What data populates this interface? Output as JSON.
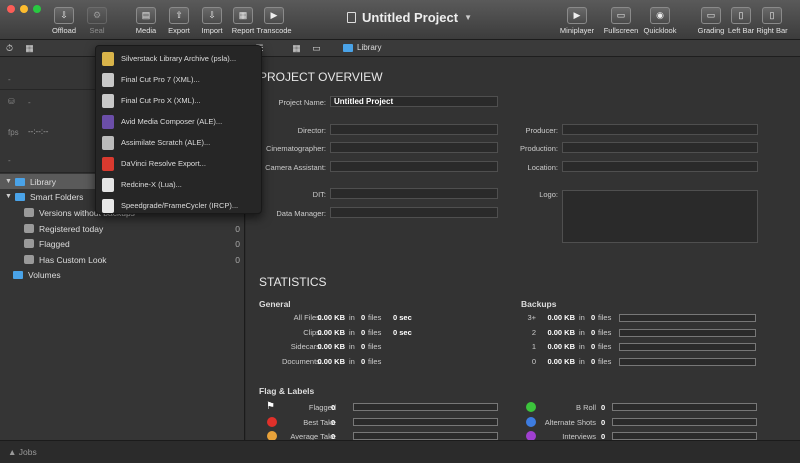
{
  "window": {
    "title": "Untitled Project"
  },
  "toolbar": {
    "offload": "Offload",
    "seal": "Seal",
    "media": "Media",
    "export": "Export",
    "import": "Import",
    "report": "Report",
    "transcode": "Transcode",
    "miniplayer": "Miniplayer",
    "fullscreen": "Fullscreen",
    "quicklook": "Quicklook",
    "grading": "Grading",
    "left_bar": "Left Bar",
    "right_bar": "Right Bar"
  },
  "breadcrumb": {
    "library": "Library"
  },
  "sidebar": {
    "meta": {
      "fps": "fps",
      "fps_value": "--:--:--",
      "dash1": "-",
      "dash2": "-",
      "dash3": "-"
    },
    "library": "Library",
    "smart_folders": "Smart Folders",
    "items": [
      {
        "label": "Versions without backups",
        "count": ""
      },
      {
        "label": "Registered today",
        "count": "0"
      },
      {
        "label": "Flagged",
        "count": "0"
      },
      {
        "label": "Has Custom Look",
        "count": "0"
      }
    ],
    "volumes": "Volumes"
  },
  "export_menu": [
    {
      "label": "Silverstack Library Archive (psla)...",
      "icon": "silverstack-icon",
      "color": "#d9b44a"
    },
    {
      "label": "Final Cut Pro 7 (XML)...",
      "icon": "final-cut-7-icon",
      "color": "#c8c8c8"
    },
    {
      "label": "Final Cut Pro X (XML)...",
      "icon": "final-cut-x-icon",
      "color": "#c8c8c8"
    },
    {
      "label": "Avid Media Composer (ALE)...",
      "icon": "avid-icon",
      "color": "#6b4ea8"
    },
    {
      "label": "Assimilate Scratch (ALE)...",
      "icon": "scratch-icon",
      "color": "#bbbbbb"
    },
    {
      "label": "DaVinci Resolve Export...",
      "icon": "davinci-icon",
      "color": "#d93a2f"
    },
    {
      "label": "Redcine-X (Lua)...",
      "icon": "redcine-icon",
      "color": "#e4e4e4"
    },
    {
      "label": "Speedgrade/FrameCycler (IRCP)...",
      "icon": "speedgrade-icon",
      "color": "#e8e8e8"
    }
  ],
  "project": {
    "heading": "PROJECT OVERVIEW",
    "project_name_label": "Project Name:",
    "project_name": "Untitled Project",
    "director": "Director:",
    "cinematographer": "Cinematographer:",
    "camera_assistant": "Camera Assistant:",
    "dit": "DIT:",
    "data_manager": "Data Manager:",
    "producer": "Producer:",
    "production": "Production:",
    "location": "Location:",
    "logo": "Logo:"
  },
  "statistics": {
    "heading": "STATISTICS",
    "general_title": "General",
    "backups_title": "Backups",
    "in": "in",
    "files": "files",
    "general": [
      {
        "label": "All Files:",
        "size": "0.00 KB",
        "files": "0",
        "duration": "0 sec"
      },
      {
        "label": "Clips:",
        "size": "0.00 KB",
        "files": "0",
        "duration": "0 sec"
      },
      {
        "label": "Sidecars:",
        "size": "0.00 KB",
        "files": "0",
        "duration": ""
      },
      {
        "label": "Documents:",
        "size": "0.00 KB",
        "files": "0",
        "duration": ""
      }
    ],
    "backups": [
      {
        "label": "3+",
        "size": "0.00 KB",
        "files": "0",
        "fill": 0
      },
      {
        "label": "2",
        "size": "0.00 KB",
        "files": "0",
        "fill": 0
      },
      {
        "label": "1",
        "size": "0.00 KB",
        "files": "0",
        "fill": 0
      },
      {
        "label": "0",
        "size": "0.00 KB",
        "files": "0",
        "fill": 0
      }
    ]
  },
  "flags": {
    "title": "Flag & Labels",
    "left": [
      {
        "label": "Flagged",
        "count": "0",
        "color": "#ffffff",
        "icon": "flag-icon"
      },
      {
        "label": "Best Take",
        "count": "0",
        "color": "#e0302a",
        "icon": "red-dot-icon"
      },
      {
        "label": "Average Take",
        "count": "0",
        "color": "#e8a23a",
        "icon": "orange-dot-icon"
      }
    ],
    "right": [
      {
        "label": "B Roll",
        "count": "0",
        "color": "#3cc43c"
      },
      {
        "label": "Alternate Shots",
        "count": "0",
        "color": "#3d7ce0"
      },
      {
        "label": "Interviews",
        "count": "0",
        "color": "#a040d0"
      }
    ]
  },
  "jobs": {
    "label": "Jobs"
  }
}
